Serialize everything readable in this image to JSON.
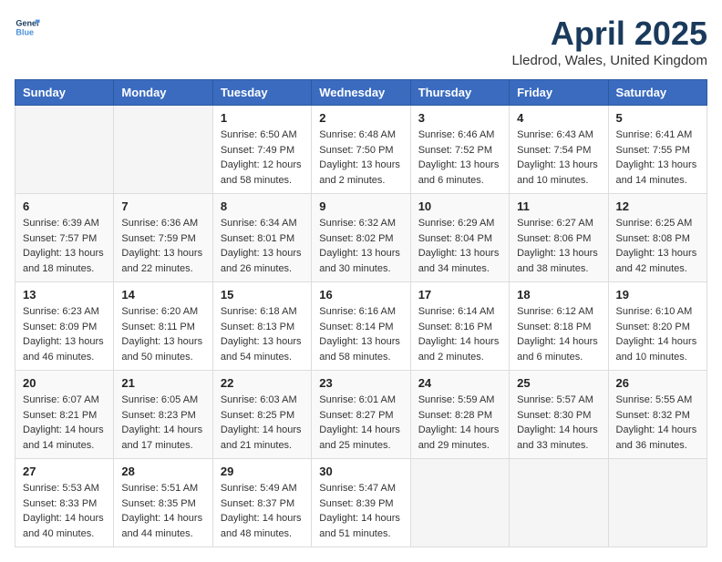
{
  "header": {
    "logo_line1": "General",
    "logo_line2": "Blue",
    "month": "April 2025",
    "location": "Lledrod, Wales, United Kingdom"
  },
  "weekdays": [
    "Sunday",
    "Monday",
    "Tuesday",
    "Wednesday",
    "Thursday",
    "Friday",
    "Saturday"
  ],
  "weeks": [
    [
      {
        "day": null,
        "info": null
      },
      {
        "day": null,
        "info": null
      },
      {
        "day": "1",
        "sunrise": "6:50 AM",
        "sunset": "7:49 PM",
        "daylight": "12 hours and 58 minutes."
      },
      {
        "day": "2",
        "sunrise": "6:48 AM",
        "sunset": "7:50 PM",
        "daylight": "13 hours and 2 minutes."
      },
      {
        "day": "3",
        "sunrise": "6:46 AM",
        "sunset": "7:52 PM",
        "daylight": "13 hours and 6 minutes."
      },
      {
        "day": "4",
        "sunrise": "6:43 AM",
        "sunset": "7:54 PM",
        "daylight": "13 hours and 10 minutes."
      },
      {
        "day": "5",
        "sunrise": "6:41 AM",
        "sunset": "7:55 PM",
        "daylight": "13 hours and 14 minutes."
      }
    ],
    [
      {
        "day": "6",
        "sunrise": "6:39 AM",
        "sunset": "7:57 PM",
        "daylight": "13 hours and 18 minutes."
      },
      {
        "day": "7",
        "sunrise": "6:36 AM",
        "sunset": "7:59 PM",
        "daylight": "13 hours and 22 minutes."
      },
      {
        "day": "8",
        "sunrise": "6:34 AM",
        "sunset": "8:01 PM",
        "daylight": "13 hours and 26 minutes."
      },
      {
        "day": "9",
        "sunrise": "6:32 AM",
        "sunset": "8:02 PM",
        "daylight": "13 hours and 30 minutes."
      },
      {
        "day": "10",
        "sunrise": "6:29 AM",
        "sunset": "8:04 PM",
        "daylight": "13 hours and 34 minutes."
      },
      {
        "day": "11",
        "sunrise": "6:27 AM",
        "sunset": "8:06 PM",
        "daylight": "13 hours and 38 minutes."
      },
      {
        "day": "12",
        "sunrise": "6:25 AM",
        "sunset": "8:08 PM",
        "daylight": "13 hours and 42 minutes."
      }
    ],
    [
      {
        "day": "13",
        "sunrise": "6:23 AM",
        "sunset": "8:09 PM",
        "daylight": "13 hours and 46 minutes."
      },
      {
        "day": "14",
        "sunrise": "6:20 AM",
        "sunset": "8:11 PM",
        "daylight": "13 hours and 50 minutes."
      },
      {
        "day": "15",
        "sunrise": "6:18 AM",
        "sunset": "8:13 PM",
        "daylight": "13 hours and 54 minutes."
      },
      {
        "day": "16",
        "sunrise": "6:16 AM",
        "sunset": "8:14 PM",
        "daylight": "13 hours and 58 minutes."
      },
      {
        "day": "17",
        "sunrise": "6:14 AM",
        "sunset": "8:16 PM",
        "daylight": "14 hours and 2 minutes."
      },
      {
        "day": "18",
        "sunrise": "6:12 AM",
        "sunset": "8:18 PM",
        "daylight": "14 hours and 6 minutes."
      },
      {
        "day": "19",
        "sunrise": "6:10 AM",
        "sunset": "8:20 PM",
        "daylight": "14 hours and 10 minutes."
      }
    ],
    [
      {
        "day": "20",
        "sunrise": "6:07 AM",
        "sunset": "8:21 PM",
        "daylight": "14 hours and 14 minutes."
      },
      {
        "day": "21",
        "sunrise": "6:05 AM",
        "sunset": "8:23 PM",
        "daylight": "14 hours and 17 minutes."
      },
      {
        "day": "22",
        "sunrise": "6:03 AM",
        "sunset": "8:25 PM",
        "daylight": "14 hours and 21 minutes."
      },
      {
        "day": "23",
        "sunrise": "6:01 AM",
        "sunset": "8:27 PM",
        "daylight": "14 hours and 25 minutes."
      },
      {
        "day": "24",
        "sunrise": "5:59 AM",
        "sunset": "8:28 PM",
        "daylight": "14 hours and 29 minutes."
      },
      {
        "day": "25",
        "sunrise": "5:57 AM",
        "sunset": "8:30 PM",
        "daylight": "14 hours and 33 minutes."
      },
      {
        "day": "26",
        "sunrise": "5:55 AM",
        "sunset": "8:32 PM",
        "daylight": "14 hours and 36 minutes."
      }
    ],
    [
      {
        "day": "27",
        "sunrise": "5:53 AM",
        "sunset": "8:33 PM",
        "daylight": "14 hours and 40 minutes."
      },
      {
        "day": "28",
        "sunrise": "5:51 AM",
        "sunset": "8:35 PM",
        "daylight": "14 hours and 44 minutes."
      },
      {
        "day": "29",
        "sunrise": "5:49 AM",
        "sunset": "8:37 PM",
        "daylight": "14 hours and 48 minutes."
      },
      {
        "day": "30",
        "sunrise": "5:47 AM",
        "sunset": "8:39 PM",
        "daylight": "14 hours and 51 minutes."
      },
      {
        "day": null,
        "info": null
      },
      {
        "day": null,
        "info": null
      },
      {
        "day": null,
        "info": null
      }
    ]
  ]
}
